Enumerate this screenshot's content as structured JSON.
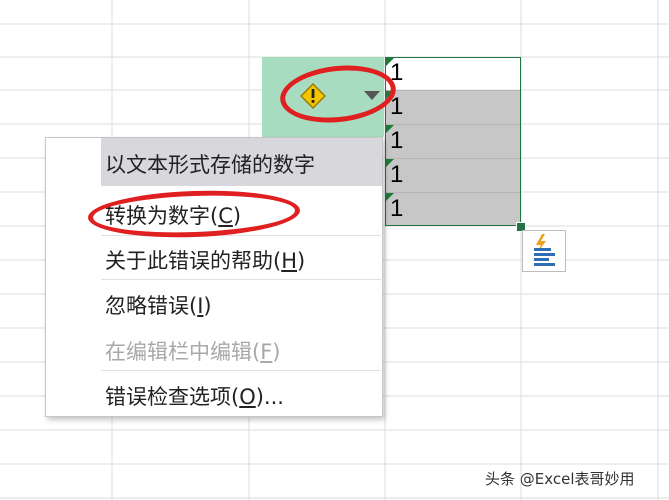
{
  "cells": [
    "1",
    "1",
    "1",
    "1",
    "1"
  ],
  "menu": {
    "header": "以文本形式存储的数字",
    "convert": {
      "text": "转换为数字(",
      "key": "C",
      "end": ")"
    },
    "help": {
      "text": "关于此错误的帮助(",
      "key": "H",
      "end": ")"
    },
    "ignore": {
      "text": "忽略错误(",
      "key": "I",
      "end": ")"
    },
    "edit_in_bar": {
      "text": "在编辑栏中编辑(",
      "key": "F",
      "end": ")"
    },
    "options": {
      "text": "错误检查选项(",
      "key": "O",
      "end": ")..."
    }
  },
  "icons": {
    "error": "warning-diamond-icon",
    "dropdown": "dropdown-arrow-icon",
    "quick_analysis": "quick-analysis-icon"
  },
  "colors": {
    "error_button_bg": "#a8dcc0",
    "warning_yellow": "#f5c400",
    "selection_green": "#217346",
    "annotation_red": "#e02020",
    "selected_cell_grey": "#c7c7c7"
  },
  "watermark": "头条 @Excel表哥妙用"
}
